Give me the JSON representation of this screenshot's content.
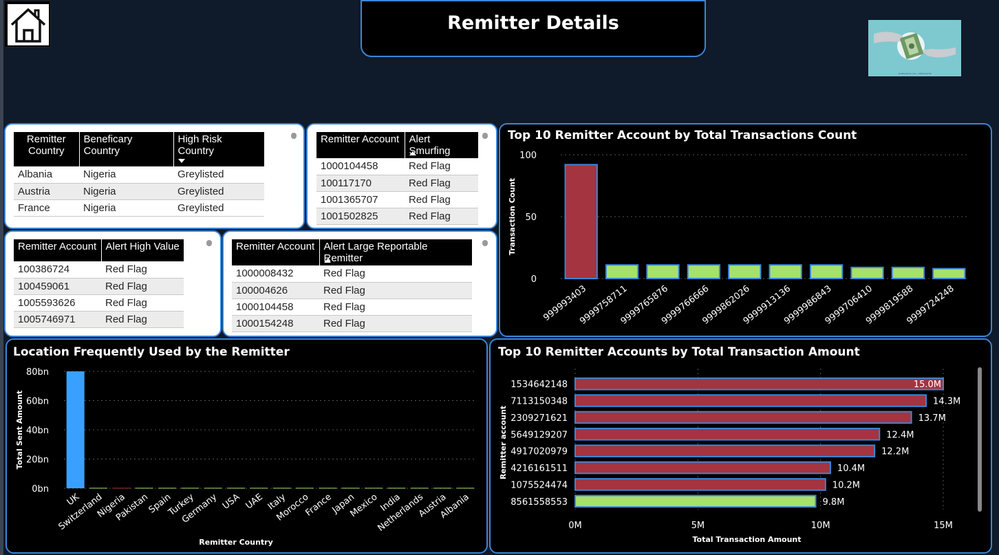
{
  "header": {
    "title": "Remitter Details",
    "home_icon": "home-icon",
    "logo_caption": "shutterstock.com · 2304112739"
  },
  "table_high_risk": {
    "headers": [
      "Remitter Country",
      "Beneficary Country",
      "High Risk Country"
    ],
    "rows": [
      [
        "Albania",
        "Nigeria",
        "Greylisted"
      ],
      [
        "Austria",
        "Nigeria",
        "Greylisted"
      ],
      [
        "France",
        "Nigeria",
        "Greylisted"
      ]
    ]
  },
  "table_smurfing": {
    "headers": [
      "Remitter Account",
      "Alert Smurfing"
    ],
    "rows": [
      [
        "1000104458",
        "Red Flag"
      ],
      [
        "100117170",
        "Red Flag"
      ],
      [
        "1001365707",
        "Red Flag"
      ],
      [
        "1001502825",
        "Red Flag"
      ]
    ]
  },
  "table_high_value": {
    "headers": [
      "Remitter Account",
      "Alert High Value"
    ],
    "rows": [
      [
        "100386724",
        "Red Flag"
      ],
      [
        "100459061",
        "Red Flag"
      ],
      [
        "1005593626",
        "Red Flag"
      ],
      [
        "1005746971",
        "Red Flag"
      ]
    ]
  },
  "table_large_reportable": {
    "headers": [
      "Remitter Account",
      "Alert Large Reportable Remitter"
    ],
    "rows": [
      [
        "1000008432",
        "Red Flag"
      ],
      [
        "100004626",
        "Red Flag"
      ],
      [
        "1000104458",
        "Red Flag"
      ],
      [
        "1000154248",
        "Red Flag"
      ]
    ]
  },
  "colors": {
    "red_bar": "#a4343f",
    "green_bar": "#a8e06e",
    "blue_bar": "#3aa0ff",
    "outline": "#3a86d8"
  },
  "chart_data": [
    {
      "id": "count",
      "type": "bar",
      "title": "Top 10 Remitter Account by Total Transactions Count",
      "xlabel": "",
      "ylabel": "Transaction Count",
      "categories": [
        "999993403",
        "9999758711",
        "9999765876",
        "9999766666",
        "9999862026",
        "9999913136",
        "9999986843",
        "9999706410",
        "9999819588",
        "9999724248"
      ],
      "values": [
        92,
        11,
        11,
        11,
        11,
        11,
        11,
        9,
        9,
        8
      ],
      "bar_colors": [
        "#a4343f",
        "#a8e06e",
        "#a8e06e",
        "#a8e06e",
        "#a8e06e",
        "#a8e06e",
        "#a8e06e",
        "#a8e06e",
        "#a8e06e",
        "#a8e06e"
      ],
      "ylim": [
        0,
        100
      ],
      "yticks": [
        "0",
        "50",
        "100"
      ],
      "grid": true
    },
    {
      "id": "location",
      "type": "bar",
      "title": "Location Frequently Used by the Remitter",
      "xlabel": "Remitter Country",
      "ylabel": "Total Sent Amount",
      "categories": [
        "UK",
        "Switzerland",
        "Nigeria",
        "Pakistan",
        "Spain",
        "Turkey",
        "Germany",
        "USA",
        "UAE",
        "Italy",
        "Morocco",
        "France",
        "Japan",
        "Mexico",
        "India",
        "Netherlands",
        "Austria",
        "Albania"
      ],
      "values": [
        80,
        0.3,
        0.3,
        0.3,
        0.3,
        0.3,
        0.3,
        0.3,
        0.3,
        0.3,
        0.3,
        0.3,
        0.3,
        0.3,
        0.3,
        0.3,
        0.3,
        0.3
      ],
      "bar_colors": [
        "#3aa0ff",
        "#a8e06e",
        "#a4343f",
        "#a8e06e",
        "#a8e06e",
        "#a8e06e",
        "#a8e06e",
        "#a8e06e",
        "#a8e06e",
        "#a8e06e",
        "#a8e06e",
        "#a8e06e",
        "#a8e06e",
        "#a8e06e",
        "#a8e06e",
        "#a8e06e",
        "#a8e06e",
        "#a8e06e"
      ],
      "ylim": [
        0,
        80
      ],
      "yticks": [
        "0bn",
        "20bn",
        "40bn",
        "60bn",
        "80bn"
      ],
      "grid": true
    },
    {
      "id": "amount",
      "type": "bar",
      "orientation": "horizontal",
      "title": "Top 10 Remitter Accounts by Total Transaction Amount",
      "xlabel": "Total Transaction Amount",
      "ylabel": "Remitter account",
      "categories": [
        "1534642148",
        "7113150348",
        "2309271621",
        "5649129207",
        "4917020979",
        "4216161511",
        "1075524474",
        "8561558553"
      ],
      "values": [
        15.0,
        14.3,
        13.7,
        12.4,
        12.2,
        10.4,
        10.2,
        9.8
      ],
      "labels": [
        "15.0M",
        "14.3M",
        "13.7M",
        "12.4M",
        "12.2M",
        "10.4M",
        "10.2M",
        "9.8M"
      ],
      "bar_colors": [
        "#a4343f",
        "#a4343f",
        "#a4343f",
        "#a4343f",
        "#a4343f",
        "#a4343f",
        "#a4343f",
        "#a8e06e"
      ],
      "xlim": [
        0,
        15
      ],
      "xticks": [
        "0M",
        "5M",
        "10M",
        "15M"
      ],
      "grid": true
    }
  ]
}
